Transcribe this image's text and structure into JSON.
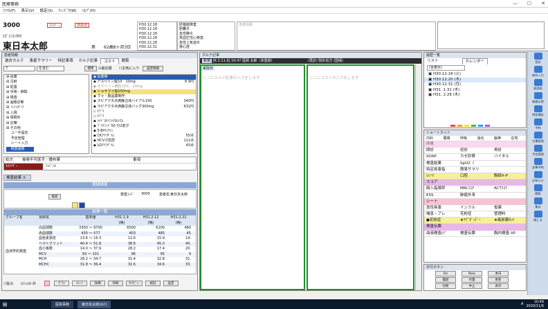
{
  "window": {
    "title": "医療事務"
  },
  "menubar": [
    "ﾌｧｲﾙ(F)",
    "表示(V)",
    "設定(S)",
    "ｳｨﾝﾄﾞｳ(W)",
    "ﾍﾙﾌﾟ(H)"
  ],
  "patient": {
    "id": "3000",
    "kana": "ﾋｶﾞｼﾆﾎﾝﾀﾛｳ",
    "name": "東日本太郎",
    "sex": "男",
    "age": "62歳8ヶ月3日",
    "badge_allergy": "ｱﾚﾙｷﾞｰ",
    "badge_infect": "感染症"
  },
  "info_col1": [
    "H30.12.18",
    "H30.12.18",
    "H30.12.18",
    "H30.12.18",
    "H30.12.18",
    "H30.12.31"
  ],
  "info_col2": [
    "肝機能障害",
    "胆囊炎",
    "急性膵炎",
    "高血圧性心疾患",
    "急性上気道炎",
    "狭心症"
  ],
  "info_box_placeholder": "患者情報",
  "left_panel": {
    "title": "患者情報",
    "tabs": [
      "過去カルテ",
      "患者サマリー",
      "特記事項",
      "カルテ記事",
      "コスト",
      "閲覧"
    ],
    "search_value": "7",
    "search_mode": "を含む",
    "btn_standard": "標準",
    "chk_recent": "最近順",
    "chk_favorite": "お気に入り",
    "btn_settings": "設定情報",
    "tree": [
      "投薬",
      "注射",
      "処置",
      "手術・麻酔",
      "検査",
      "画像診断",
      "リハビリ",
      "入院",
      "保険外",
      "診察",
      "その他",
      "ユーザ設定",
      "予定管理",
      "シート入力",
      "検査画像"
    ],
    "orders": [
      "投薬等",
      "アスベリン錠10　10mg",
      "サワシリン細粒10%　10mg",
      "ジョサマイ錠250mg",
      "ヴォ・製品薬制作",
      "ラビアクタ点滴静注液バイアル150",
      "ラビアクタ点滴静注液バッグ300mg",
      "ﾅﾌﾞﾘ",
      "ﾅﾌﾞﾘ",
      "ﾊｲﾄﾞﾛｷｿﾌｧｸﾛﾙｼｳﾑ",
      "ﾌﾞﾘﾅﾐﾝﾄﾞ50 分2前夕",
      "5-Bｷｻﾝﾁｼﾝ",
      "CKｱｲｿｻﾞｲﾑ",
      "HCVｺｱ抗原",
      "LDｱｲｿｻﾞｲﾑ"
    ],
    "order_values": [
      "",
      "8.9円",
      "",
      "",
      "",
      "340円",
      "631円",
      "",
      "",
      "",
      "",
      "",
      "55点",
      "111点",
      "43点"
    ],
    "tbl_head": [
      "処方",
      "後発不可医手／撞布薬",
      "事項"
    ],
    "tbl_row": [
      "ﾈｵﾗｲｻﾞｰ",
      "ﾌﾚｼﾞｬﾙ"
    ]
  },
  "lab": {
    "tab": "検査結果",
    "header": "期間検索",
    "dept_label": "検査ｺｰﾄﾞ",
    "dept_value": "3000",
    "name_label": "患者名",
    "name_value": "東日本太郎",
    "btn_search": "検索",
    "list_header": "結果一覧",
    "col_group": "グループ名",
    "col_item": "項目名",
    "col_ref": "基準値",
    "dates": [
      "H31.1.9",
      "H31.2.12",
      "H31.2.22"
    ],
    "unit_label": "(時)",
    "group": "血液学的検査",
    "rows": [
      {
        "name": "白血球数",
        "ref": "3300 ～ 9700",
        "v": [
          "6500",
          "6100",
          "480"
        ]
      },
      {
        "name": "赤血球数",
        "ref": "430 ～ 577",
        "v": [
          "403",
          "485",
          "45"
        ]
      },
      {
        "name": "血色素測定",
        "ref": "13.6 ～ 16.3",
        "v": [
          "12.6",
          "15.9",
          "14."
        ]
      },
      {
        "name": "ヘマトクリット",
        "ref": "40.4 ～ 51.8",
        "v": [
          "38.6",
          "45.0",
          "40."
        ]
      },
      {
        "name": "血小板数",
        "ref": "14.0 ～ 37.9",
        "v": [
          "28.2",
          "17.4",
          "20."
        ]
      },
      {
        "name": "MCV",
        "ref": "83 ～ 101",
        "v": [
          "96",
          "95",
          "9"
        ]
      },
      {
        "name": "MCH",
        "ref": "28.2 ～ 34.7",
        "v": [
          "31.4",
          "32.8",
          "31."
        ]
      },
      {
        "name": "MCHC",
        "ref": "31.8 ～ 36.4",
        "v": [
          "32.6",
          "34.6",
          "33."
        ]
      }
    ],
    "chk_expand": "拡大",
    "chk_filter": "ﾌｨﾙﾀｰ外",
    "btns": [
      "ｸﾞﾗﾌ",
      "ﾁｬｰﾄ",
      "詳細",
      "印刷",
      "ｸﾘｱﾋﾞｭｰ",
      "総記",
      "設定"
    ]
  },
  "card": {
    "title": "カルテ記事",
    "hdr_badge": "新規",
    "hdr_text": "[R 2.11.6] 10:47 医師 太郎（未登録）",
    "hdr_right": "(再診) 院外処方 (国保)",
    "sub_badge": "来院日",
    "left_placeholder": "ここにカルテ記事の入力をします",
    "right_placeholder": "ここにコストの入力をします"
  },
  "history": {
    "title": "履歴一覧",
    "tab_list": "リスト",
    "tab_calendar": "カレンダー",
    "filter": "(全表示)",
    "items": [
      "H30.12.18 (火)",
      "H30.12.20 (木)",
      "H30.12.31 (月)",
      "H31. 1.31 (木)",
      "H31. 2.28 (木)"
    ]
  },
  "shortcut": {
    "title": "ショートカット",
    "tabs": [
      "内科",
      "循環",
      "呼吸",
      "消化",
      "脳神",
      "在宅"
    ],
    "rows": [
      [
        "問診",
        "初診",
        "再診"
      ],
      [
        "SOAP",
        "カゼ診察",
        "バイタル"
      ],
      [
        "検査結果",
        "SpO2（",
        ""
      ],
      [
        "特定疾患指",
        "簡易サマリ",
        ""
      ]
    ],
    "row_yellow": [
      "ｼｪｰﾏ",
      "口腔",
      "胸部X-P"
    ],
    "sec_score": "スコア",
    "rows2": [
      [
        "殴入指導評",
        "MRCｽｺｱ",
        "ACTｽｺｱ"
      ],
      [
        "ESS",
        "肺疲外来",
        ""
      ]
    ],
    "sec_sheet": "シート",
    "rows3": [
      [
        "急性疾患",
        "インフル",
        "投薬"
      ],
      [
        "喘息・アレ",
        "花粉症",
        "管理料"
      ]
    ],
    "row_pink": [
      "●花粉症",
      "★ｱﾌﾞｾﾞﾝﾃﾞｰ",
      "★風邪薬ｾｯﾄ"
    ],
    "sec_exam": "検査伝票",
    "row_last": [
      "血液検査(ﾊﾟ",
      "検査伝票",
      "胸内検査-XP"
    ],
    "nav_title": "日付ボタン",
    "nav_btns": [
      "Do",
      "New",
      "本日",
      "履歴",
      "付箋",
      "更新",
      "比較",
      "中止",
      "表示"
    ]
  },
  "right_sidebar": [
    "受診",
    "病名入力",
    "経過表",
    "検査伝票",
    "特定健診",
    "予約",
    "文書管理",
    "予定管理",
    "診療予約",
    "お知らせ",
    "閲覧",
    "集計",
    "閉じる"
  ],
  "taskbar": {
    "item1": "医院事務",
    "item2": "東日本太郎(ｶﾙﾃ)",
    "time": "10:49",
    "ime": "A",
    "date": "2020/11/6"
  }
}
